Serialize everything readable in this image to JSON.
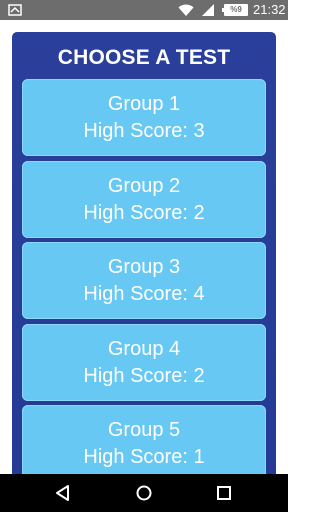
{
  "status_bar": {
    "time": "21:32",
    "battery_level": "%9",
    "icons": [
      "notification-icon",
      "wifi-icon",
      "signal-icon",
      "battery-icon"
    ]
  },
  "title": "CHOOSE A TEST",
  "groups": [
    {
      "name": "Group 1",
      "score": "High Score: 3"
    },
    {
      "name": "Group 2",
      "score": "High Score: 2"
    },
    {
      "name": "Group 3",
      "score": "High Score: 4"
    },
    {
      "name": "Group 4",
      "score": "High Score: 2"
    },
    {
      "name": "Group 5",
      "score": "High Score: 1"
    }
  ],
  "nav_bar": {
    "icons": [
      "back-icon",
      "home-icon",
      "recents-icon"
    ]
  },
  "colors": {
    "panel": "#2a3f9b",
    "card": "#67c8f3",
    "status_bar": "#6d6d6d",
    "nav_bar": "#000000"
  }
}
